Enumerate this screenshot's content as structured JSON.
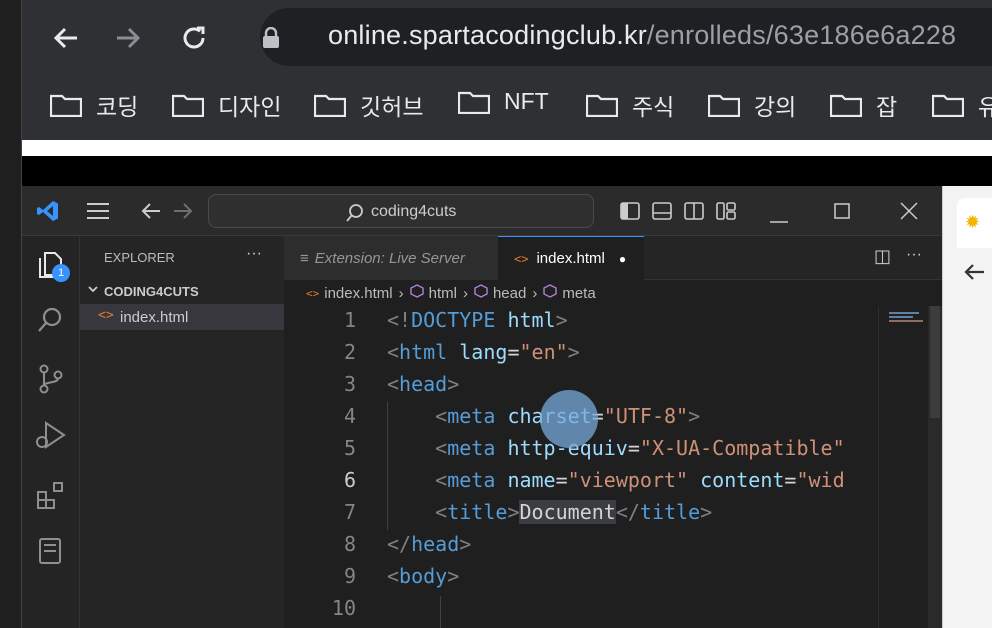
{
  "browser": {
    "url_host": "online.spartacodingclub.kr",
    "url_path": "/enrolleds/63e186e6a228",
    "bookmarks": [
      "코딩",
      "디자인",
      "깃허브",
      "NFT",
      "주식",
      "강의",
      "잡",
      "유"
    ]
  },
  "vscode": {
    "search_text": "coding4cuts",
    "explorer_title": "EXPLORER",
    "explorer_more": "···",
    "explorer_badge": "1",
    "folder_name": "CODING4CUTS",
    "file_name": "index.html",
    "tabs": [
      {
        "label": "Extension: Live Server",
        "icon": "≡"
      },
      {
        "label": "index.html",
        "icon": "<>",
        "modified": "●"
      }
    ],
    "tab_actions": {
      "split": "◫",
      "more": "···"
    },
    "breadcrumb": [
      "index.html",
      "html",
      "head",
      "meta"
    ],
    "line_numbers": [
      "1",
      "2",
      "3",
      "4",
      "5",
      "6",
      "7",
      "8",
      "9",
      "10"
    ]
  },
  "colors": {
    "accent": "#3794ff",
    "tag": "#569cd6",
    "attr": "#9cdcfe",
    "string": "#ce9178"
  }
}
